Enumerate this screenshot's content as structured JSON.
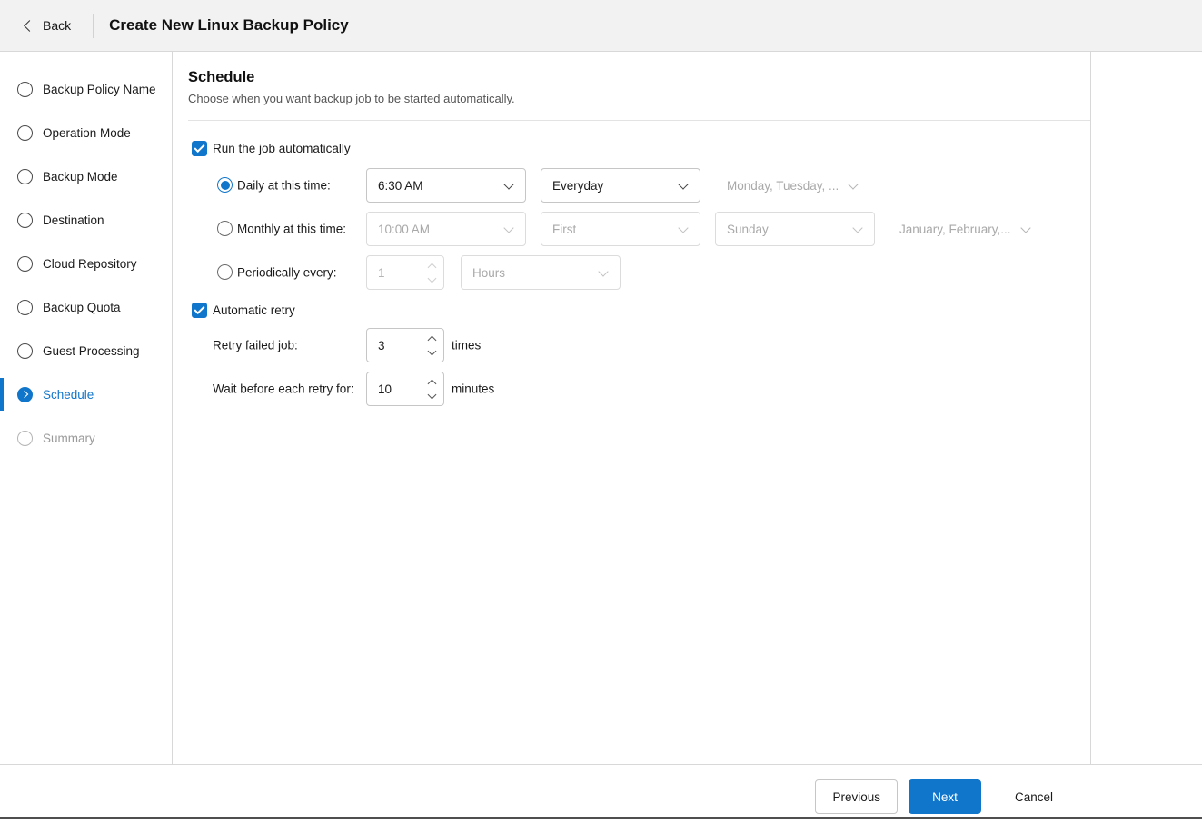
{
  "colors": {
    "accent": "#1076cb"
  },
  "icons": {
    "back": "chevron-left",
    "active_step": "chevron-right",
    "dropdown": "chevron-down",
    "checkbox_check": "check",
    "spinner_up": "chevron-up",
    "spinner_down": "chevron-down"
  },
  "header": {
    "back_label": "Back",
    "title": "Create New Linux Backup Policy"
  },
  "sidebar": {
    "items": [
      {
        "label": "Backup Policy Name",
        "state": "default"
      },
      {
        "label": "Operation Mode",
        "state": "default"
      },
      {
        "label": "Backup Mode",
        "state": "default"
      },
      {
        "label": "Destination",
        "state": "default"
      },
      {
        "label": "Cloud Repository",
        "state": "default"
      },
      {
        "label": "Backup Quota",
        "state": "default"
      },
      {
        "label": "Guest Processing",
        "state": "default"
      },
      {
        "label": "Schedule",
        "state": "active"
      },
      {
        "label": "Summary",
        "state": "disabled"
      }
    ]
  },
  "main": {
    "section_title": "Schedule",
    "section_subtitle": "Choose when you want backup job to be started automatically.",
    "run_job_checkbox": {
      "label": "Run the job automatically",
      "checked": true
    },
    "daily": {
      "label": "Daily at this time:",
      "selected": true,
      "time": "6:30 AM",
      "frequency": "Everyday",
      "days": "Monday, Tuesday, ..."
    },
    "monthly": {
      "label": "Monthly at this time:",
      "selected": false,
      "time": "10:00 AM",
      "ordinal": "First",
      "weekday": "Sunday",
      "months": "January, February,..."
    },
    "periodically": {
      "label": "Periodically every:",
      "selected": false,
      "value": "1",
      "unit": "Hours"
    },
    "automatic_retry": {
      "label": "Automatic retry",
      "checked": true
    },
    "retry": {
      "label": "Retry failed job:",
      "value": "3",
      "suffix": "times"
    },
    "wait": {
      "label": "Wait before each retry for:",
      "value": "10",
      "suffix": "minutes"
    }
  },
  "footer": {
    "previous": "Previous",
    "next": "Next",
    "cancel": "Cancel"
  }
}
